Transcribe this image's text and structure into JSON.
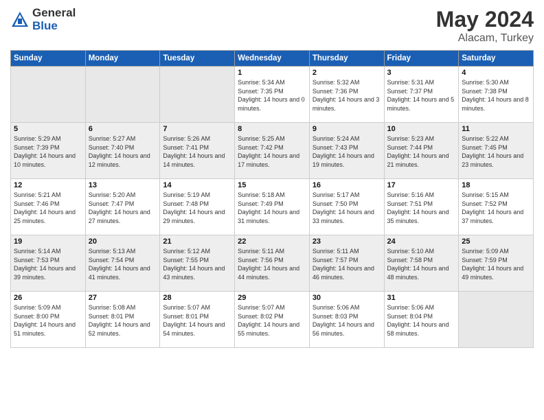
{
  "header": {
    "logo_general": "General",
    "logo_blue": "Blue",
    "title": "May 2024",
    "location": "Alacam, Turkey"
  },
  "weekdays": [
    "Sunday",
    "Monday",
    "Tuesday",
    "Wednesday",
    "Thursday",
    "Friday",
    "Saturday"
  ],
  "weeks": [
    [
      {
        "day": "",
        "sunrise": "",
        "sunset": "",
        "daylight": ""
      },
      {
        "day": "",
        "sunrise": "",
        "sunset": "",
        "daylight": ""
      },
      {
        "day": "",
        "sunrise": "",
        "sunset": "",
        "daylight": ""
      },
      {
        "day": "1",
        "sunrise": "Sunrise: 5:34 AM",
        "sunset": "Sunset: 7:35 PM",
        "daylight": "Daylight: 14 hours and 0 minutes."
      },
      {
        "day": "2",
        "sunrise": "Sunrise: 5:32 AM",
        "sunset": "Sunset: 7:36 PM",
        "daylight": "Daylight: 14 hours and 3 minutes."
      },
      {
        "day": "3",
        "sunrise": "Sunrise: 5:31 AM",
        "sunset": "Sunset: 7:37 PM",
        "daylight": "Daylight: 14 hours and 5 minutes."
      },
      {
        "day": "4",
        "sunrise": "Sunrise: 5:30 AM",
        "sunset": "Sunset: 7:38 PM",
        "daylight": "Daylight: 14 hours and 8 minutes."
      }
    ],
    [
      {
        "day": "5",
        "sunrise": "Sunrise: 5:29 AM",
        "sunset": "Sunset: 7:39 PM",
        "daylight": "Daylight: 14 hours and 10 minutes."
      },
      {
        "day": "6",
        "sunrise": "Sunrise: 5:27 AM",
        "sunset": "Sunset: 7:40 PM",
        "daylight": "Daylight: 14 hours and 12 minutes."
      },
      {
        "day": "7",
        "sunrise": "Sunrise: 5:26 AM",
        "sunset": "Sunset: 7:41 PM",
        "daylight": "Daylight: 14 hours and 14 minutes."
      },
      {
        "day": "8",
        "sunrise": "Sunrise: 5:25 AM",
        "sunset": "Sunset: 7:42 PM",
        "daylight": "Daylight: 14 hours and 17 minutes."
      },
      {
        "day": "9",
        "sunrise": "Sunrise: 5:24 AM",
        "sunset": "Sunset: 7:43 PM",
        "daylight": "Daylight: 14 hours and 19 minutes."
      },
      {
        "day": "10",
        "sunrise": "Sunrise: 5:23 AM",
        "sunset": "Sunset: 7:44 PM",
        "daylight": "Daylight: 14 hours and 21 minutes."
      },
      {
        "day": "11",
        "sunrise": "Sunrise: 5:22 AM",
        "sunset": "Sunset: 7:45 PM",
        "daylight": "Daylight: 14 hours and 23 minutes."
      }
    ],
    [
      {
        "day": "12",
        "sunrise": "Sunrise: 5:21 AM",
        "sunset": "Sunset: 7:46 PM",
        "daylight": "Daylight: 14 hours and 25 minutes."
      },
      {
        "day": "13",
        "sunrise": "Sunrise: 5:20 AM",
        "sunset": "Sunset: 7:47 PM",
        "daylight": "Daylight: 14 hours and 27 minutes."
      },
      {
        "day": "14",
        "sunrise": "Sunrise: 5:19 AM",
        "sunset": "Sunset: 7:48 PM",
        "daylight": "Daylight: 14 hours and 29 minutes."
      },
      {
        "day": "15",
        "sunrise": "Sunrise: 5:18 AM",
        "sunset": "Sunset: 7:49 PM",
        "daylight": "Daylight: 14 hours and 31 minutes."
      },
      {
        "day": "16",
        "sunrise": "Sunrise: 5:17 AM",
        "sunset": "Sunset: 7:50 PM",
        "daylight": "Daylight: 14 hours and 33 minutes."
      },
      {
        "day": "17",
        "sunrise": "Sunrise: 5:16 AM",
        "sunset": "Sunset: 7:51 PM",
        "daylight": "Daylight: 14 hours and 35 minutes."
      },
      {
        "day": "18",
        "sunrise": "Sunrise: 5:15 AM",
        "sunset": "Sunset: 7:52 PM",
        "daylight": "Daylight: 14 hours and 37 minutes."
      }
    ],
    [
      {
        "day": "19",
        "sunrise": "Sunrise: 5:14 AM",
        "sunset": "Sunset: 7:53 PM",
        "daylight": "Daylight: 14 hours and 39 minutes."
      },
      {
        "day": "20",
        "sunrise": "Sunrise: 5:13 AM",
        "sunset": "Sunset: 7:54 PM",
        "daylight": "Daylight: 14 hours and 41 minutes."
      },
      {
        "day": "21",
        "sunrise": "Sunrise: 5:12 AM",
        "sunset": "Sunset: 7:55 PM",
        "daylight": "Daylight: 14 hours and 43 minutes."
      },
      {
        "day": "22",
        "sunrise": "Sunrise: 5:11 AM",
        "sunset": "Sunset: 7:56 PM",
        "daylight": "Daylight: 14 hours and 44 minutes."
      },
      {
        "day": "23",
        "sunrise": "Sunrise: 5:11 AM",
        "sunset": "Sunset: 7:57 PM",
        "daylight": "Daylight: 14 hours and 46 minutes."
      },
      {
        "day": "24",
        "sunrise": "Sunrise: 5:10 AM",
        "sunset": "Sunset: 7:58 PM",
        "daylight": "Daylight: 14 hours and 48 minutes."
      },
      {
        "day": "25",
        "sunrise": "Sunrise: 5:09 AM",
        "sunset": "Sunset: 7:59 PM",
        "daylight": "Daylight: 14 hours and 49 minutes."
      }
    ],
    [
      {
        "day": "26",
        "sunrise": "Sunrise: 5:09 AM",
        "sunset": "Sunset: 8:00 PM",
        "daylight": "Daylight: 14 hours and 51 minutes."
      },
      {
        "day": "27",
        "sunrise": "Sunrise: 5:08 AM",
        "sunset": "Sunset: 8:01 PM",
        "daylight": "Daylight: 14 hours and 52 minutes."
      },
      {
        "day": "28",
        "sunrise": "Sunrise: 5:07 AM",
        "sunset": "Sunset: 8:01 PM",
        "daylight": "Daylight: 14 hours and 54 minutes."
      },
      {
        "day": "29",
        "sunrise": "Sunrise: 5:07 AM",
        "sunset": "Sunset: 8:02 PM",
        "daylight": "Daylight: 14 hours and 55 minutes."
      },
      {
        "day": "30",
        "sunrise": "Sunrise: 5:06 AM",
        "sunset": "Sunset: 8:03 PM",
        "daylight": "Daylight: 14 hours and 56 minutes."
      },
      {
        "day": "31",
        "sunrise": "Sunrise: 5:06 AM",
        "sunset": "Sunset: 8:04 PM",
        "daylight": "Daylight: 14 hours and 58 minutes."
      },
      {
        "day": "",
        "sunrise": "",
        "sunset": "",
        "daylight": ""
      }
    ]
  ]
}
